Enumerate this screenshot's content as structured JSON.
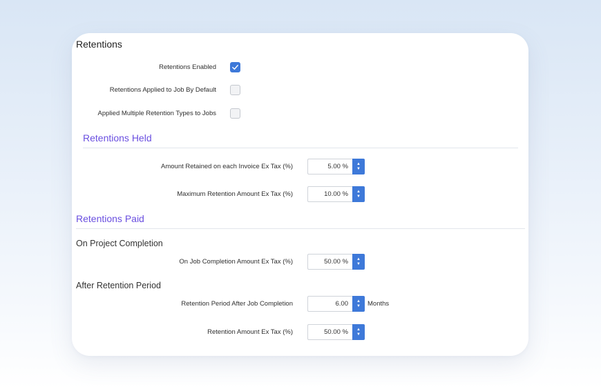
{
  "page": {
    "title": "Retentions"
  },
  "checkboxes": [
    {
      "label": "Retentions Enabled",
      "checked": true
    },
    {
      "label": "Retentions Applied to Job By Default",
      "checked": false
    },
    {
      "label": "Applied Multiple Retention Types to Jobs",
      "checked": false
    }
  ],
  "held": {
    "heading": "Retentions Held",
    "fields": [
      {
        "label": "Amount Retained on each Invoice Ex Tax (%)",
        "value": "5.00 %"
      },
      {
        "label": "Maximum Retention Amount Ex Tax (%)",
        "value": "10.00 %"
      }
    ]
  },
  "paid": {
    "heading": "Retentions Paid",
    "completion": {
      "heading": "On Project Completion",
      "field": {
        "label": "On Job Completion Amount Ex Tax (%)",
        "value": "50.00 %"
      }
    },
    "period": {
      "heading": "After Retention Period",
      "fields": [
        {
          "label": "Retention Period After Job Completion",
          "value": "6.00",
          "unit": "Months"
        },
        {
          "label": "Retention Amount Ex Tax (%)",
          "value": "50.00 %"
        }
      ]
    }
  },
  "colors": {
    "accent": "#3e79d9",
    "section_heading": "#6a4fe0"
  },
  "icons": {
    "checkmark": "check-icon",
    "spin_up": "chevron-up-icon",
    "spin_down": "chevron-down-icon"
  }
}
